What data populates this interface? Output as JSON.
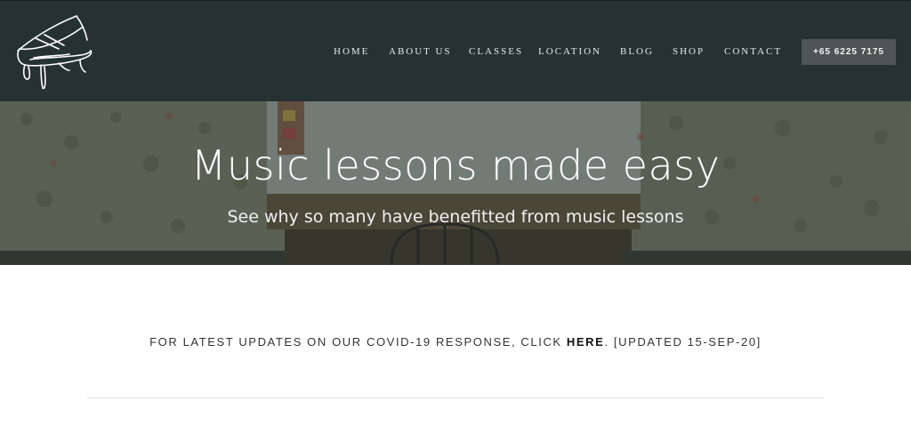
{
  "header": {
    "nav": [
      {
        "label": "HOME"
      },
      {
        "label": "ABOUT US"
      },
      {
        "label": "CLASSES"
      },
      {
        "label": "LOCATION"
      },
      {
        "label": "BLOG"
      },
      {
        "label": "SHOP"
      },
      {
        "label": "CONTACT"
      }
    ],
    "phone": "+65 6225 7175"
  },
  "hero": {
    "title": "Music lessons made easy",
    "subtitle": "See why so many have benefitted from music lessons"
  },
  "notice": {
    "prefix": "FOR LATEST UPDATES ON OUR COVID-19 RESPONSE, CLICK ",
    "link": "HERE",
    "suffix": ". [UPDATED 15-SEP-20]"
  },
  "colors": {
    "header_bg": "#263232",
    "phone_bg": "#4d5555",
    "text_dark": "#333333"
  }
}
